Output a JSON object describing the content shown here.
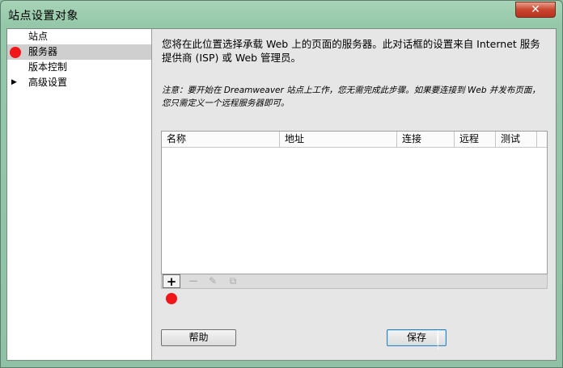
{
  "window": {
    "title": "站点设置对象",
    "close_label": "✕"
  },
  "sidebar": {
    "items": [
      {
        "label": "站点",
        "selected": false,
        "expandable": false
      },
      {
        "label": "服务器",
        "selected": true,
        "expandable": false
      },
      {
        "label": "版本控制",
        "selected": false,
        "expandable": false
      },
      {
        "label": "高级设置",
        "selected": false,
        "expandable": true,
        "arrow": "▶"
      }
    ]
  },
  "main": {
    "description": "您将在此位置选择承载 Web 上的页面的服务器。此对话框的设置来自 Internet 服务提供商 (ISP) 或 Web 管理员。",
    "note": "注意：要开始在 Dreamweaver 站点上工作，您无需完成此步骤。如果要连接到 Web 并发布页面，您只需定义一个远程服务器即可。",
    "table": {
      "columns": [
        "名称",
        "地址",
        "连接",
        "远程",
        "测试"
      ],
      "rows": []
    },
    "toolbar": {
      "add": "+",
      "remove": "−",
      "edit": "✎",
      "duplicate": "⧉"
    }
  },
  "footer": {
    "help_label": "帮助",
    "save_label": "保存"
  },
  "colors": {
    "annotation_marker": "#f0161a",
    "selected_row": "#cfcfcf"
  }
}
